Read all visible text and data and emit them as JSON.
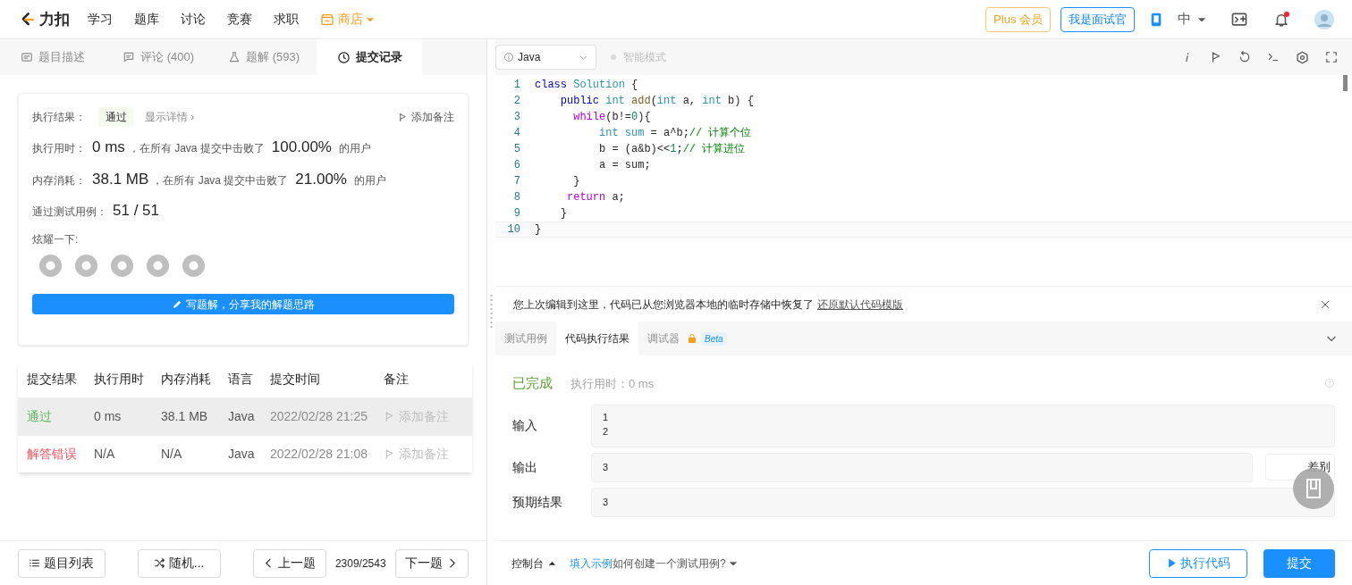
{
  "nav": {
    "logo": "力扣",
    "items": [
      {
        "label": "学习",
        "kind": "link"
      },
      {
        "label": "题库",
        "kind": "link"
      },
      {
        "label": "讨论",
        "kind": "link"
      },
      {
        "label": "竞赛",
        "kind": "link"
      },
      {
        "label": "求职",
        "kind": "link"
      },
      {
        "label": "商店",
        "kind": "store"
      }
    ],
    "plus": "Plus 会员",
    "interviewer": "我是面试官",
    "language": "中",
    "notification": true
  },
  "left_tabs": [
    {
      "label": "题目描述",
      "selected": false
    },
    {
      "label": "评论 (400)",
      "selected": false
    },
    {
      "label": "题解 (593)",
      "selected": false
    },
    {
      "label": "提交记录",
      "selected": true
    }
  ],
  "result": {
    "label": "执行结果：",
    "status": "通过",
    "details": "显示详情 ›",
    "add_note": "添加备注",
    "stats": [
      {
        "label": "执行用时：",
        "value": "0 ms",
        "middle": "，在所有 Java 提交中击败了",
        "percent": "100.00%",
        "suffix": "的用户"
      },
      {
        "label": "内存消耗：",
        "value": "38.1 MB",
        "middle": "，在所有 Java 提交中击败了",
        "percent": "21.00%",
        "suffix": "的用户"
      }
    ],
    "tests_label": "通过测试用例：",
    "tests_value": "51 / 51",
    "share_label": "炫耀一下:",
    "write_button": "写题解，分享我的解题思路"
  },
  "submissions": {
    "columns": [
      "提交结果",
      "执行用时",
      "内存消耗",
      "语言",
      "提交时间",
      "备注"
    ],
    "rows": [
      {
        "result": "通过",
        "kind": "accepted",
        "time": "0 ms",
        "memory": "38.1 MB",
        "language": "Java",
        "submitted": "2022/02/28 21:25",
        "note": "添加备注",
        "selected": true
      },
      {
        "result": "解答错误",
        "kind": "wrong",
        "time": "N/A",
        "memory": "N/A",
        "language": "Java",
        "submitted": "2022/02/28 21:08",
        "note": "添加备注",
        "selected": false
      }
    ]
  },
  "editor": {
    "language": "Java",
    "smart_mode": "智能模式",
    "smart_mode_on": false,
    "lines": [
      {
        "number": "1",
        "tokens": [
          {
            "kind": "keyword",
            "text": "class "
          },
          {
            "kind": "type",
            "text": "Solution"
          },
          {
            "kind": "plain",
            "text": " {"
          }
        ]
      },
      {
        "number": "2",
        "tokens": [
          {
            "kind": "keyword",
            "text": "    public "
          },
          {
            "kind": "type",
            "text": "int "
          },
          {
            "kind": "func",
            "text": "add"
          },
          {
            "kind": "plain",
            "text": "("
          },
          {
            "kind": "type",
            "text": "int"
          },
          {
            "kind": "plain",
            "text": " a, "
          },
          {
            "kind": "type",
            "text": "int"
          },
          {
            "kind": "plain",
            "text": " b) {"
          }
        ]
      },
      {
        "number": "3",
        "tokens": [
          {
            "kind": "control",
            "text": "      while"
          },
          {
            "kind": "plain",
            "text": "(b!="
          },
          {
            "kind": "number",
            "text": "0"
          },
          {
            "kind": "plain",
            "text": "){"
          }
        ]
      },
      {
        "number": "4",
        "tokens": [
          {
            "kind": "type",
            "text": "          int sum"
          },
          {
            "kind": "plain",
            "text": " = a^b;"
          },
          {
            "kind": "comment",
            "text": "// 计算个位"
          }
        ]
      },
      {
        "number": "5",
        "tokens": [
          {
            "kind": "plain",
            "text": "          b = (a&b)<<"
          },
          {
            "kind": "number",
            "text": "1"
          },
          {
            "kind": "plain",
            "text": ";"
          },
          {
            "kind": "comment",
            "text": "// 计算进位"
          }
        ]
      },
      {
        "number": "6",
        "tokens": [
          {
            "kind": "plain",
            "text": "          a = sum;"
          }
        ]
      },
      {
        "number": "7",
        "tokens": [
          {
            "kind": "plain",
            "text": "      }"
          }
        ]
      },
      {
        "number": "8",
        "tokens": [
          {
            "kind": "control",
            "text": "     return"
          },
          {
            "kind": "plain",
            "text": " a;"
          }
        ]
      },
      {
        "number": "9",
        "tokens": [
          {
            "kind": "plain",
            "text": "    }"
          }
        ]
      },
      {
        "number": "10",
        "tokens": [
          {
            "kind": "plain",
            "text": "}"
          }
        ]
      }
    ]
  },
  "notice": {
    "text": "您上次编辑到这里，代码已从您浏览器本地的临时存储中恢复了",
    "link": "还原默认代码模版"
  },
  "console_tabs": [
    {
      "label": "测试用例",
      "selected": false,
      "locked": false
    },
    {
      "label": "代码执行结果",
      "selected": true,
      "locked": false
    },
    {
      "label": "调试器",
      "selected": false,
      "locked": true,
      "badge": "Beta"
    }
  ],
  "run_result": {
    "status": "已完成",
    "time": "执行用时：0 ms",
    "fields": [
      {
        "label": "输入",
        "value": "1\n2"
      },
      {
        "label": "输出",
        "value": "3"
      },
      {
        "label": "预期结果",
        "value": "3"
      }
    ],
    "diff": "差别"
  },
  "bottom": {
    "list": "题目列表",
    "random": "随机...",
    "prev": "上一题",
    "progress": "2309/2543",
    "next": "下一题",
    "console": "控制台",
    "fill_example": "填入示例",
    "how_to": "如何创建一个测试用例?",
    "run": "执行代码",
    "submit": "提交"
  }
}
